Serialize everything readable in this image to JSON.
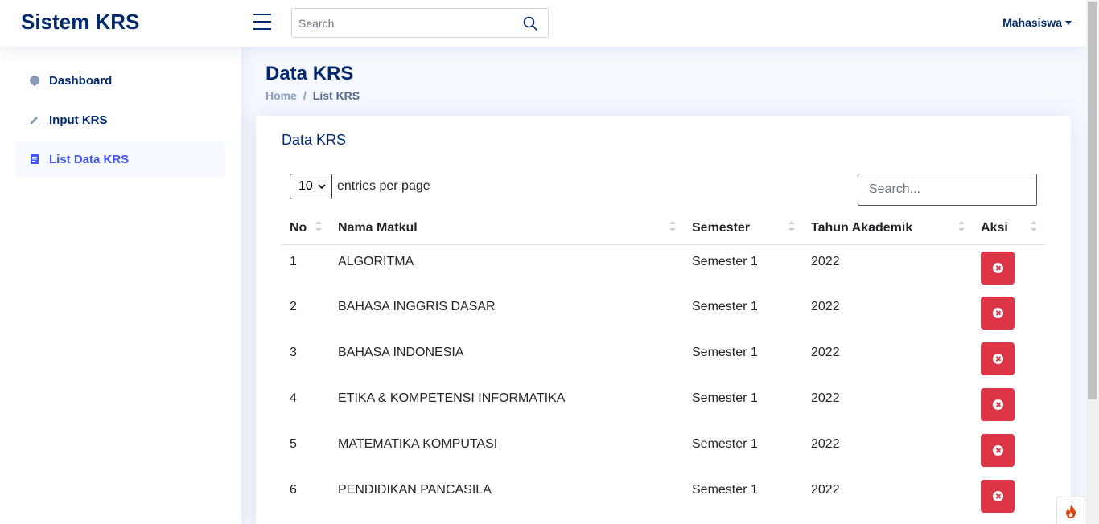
{
  "header": {
    "logo": "Sistem KRS",
    "search_placeholder": "Search",
    "user_label": "Mahasiswa"
  },
  "sidebar": {
    "items": [
      {
        "label": "Dashboard",
        "icon": "dashboard-icon"
      },
      {
        "label": "Input KRS",
        "icon": "pencil-icon"
      },
      {
        "label": "List Data KRS",
        "icon": "document-icon",
        "active": true
      }
    ]
  },
  "page": {
    "title": "Data KRS",
    "breadcrumb": {
      "home": "Home",
      "separator": "/",
      "current": "List KRS"
    }
  },
  "card": {
    "title": "Data KRS",
    "entries_value": "10",
    "entries_label": "entries per page",
    "search_placeholder": "Search...",
    "columns": [
      "No",
      "Nama Matkul",
      "Semester",
      "Tahun Akademik",
      "Aksi"
    ],
    "rows": [
      {
        "no": "1",
        "matkul": "ALGORITMA",
        "semester": "Semester 1",
        "tahun": "2022"
      },
      {
        "no": "2",
        "matkul": "BAHASA INGGRIS DASAR",
        "semester": "Semester 1",
        "tahun": "2022"
      },
      {
        "no": "3",
        "matkul": "BAHASA INDONESIA",
        "semester": "Semester 1",
        "tahun": "2022"
      },
      {
        "no": "4",
        "matkul": "ETIKA & KOMPETENSI INFORMATIKA",
        "semester": "Semester 1",
        "tahun": "2022"
      },
      {
        "no": "5",
        "matkul": "MATEMATIKA KOMPUTASI",
        "semester": "Semester 1",
        "tahun": "2022"
      },
      {
        "no": "6",
        "matkul": "PENDIDIKAN PANCASILA",
        "semester": "Semester 1",
        "tahun": "2022"
      }
    ]
  },
  "colors": {
    "primary": "#012970",
    "accent": "#4154f1",
    "danger": "#dc3545",
    "background": "#f6f9ff"
  }
}
